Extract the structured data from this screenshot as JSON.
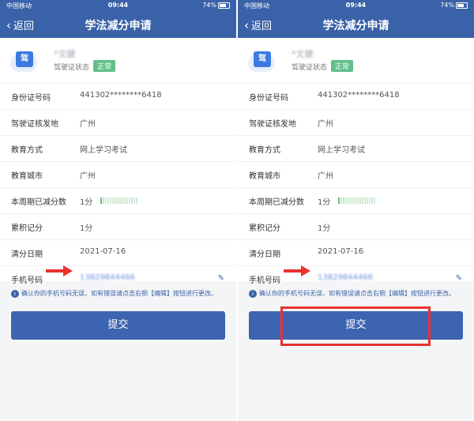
{
  "panels": [
    {
      "status": {
        "carrier": "中国移动",
        "time": "09:44",
        "battery": "74%"
      },
      "nav": {
        "back": "返回",
        "title": "学法减分申请"
      },
      "profile": {
        "name": "*文健",
        "license_label": "驾驶证状态",
        "license_status": "正常",
        "avatar_glyph": "驾"
      },
      "rows": [
        {
          "label": "身份证号码",
          "value": "441302********6418"
        },
        {
          "label": "驾驶证核发地",
          "value": "广州"
        },
        {
          "label": "教育方式",
          "value": "网上学习考试"
        },
        {
          "label": "教育城市",
          "value": "广州"
        },
        {
          "label": "本周期已减分数",
          "value": "1分",
          "progress_fraction": 0.08
        },
        {
          "label": "累积记分",
          "value": "1分"
        },
        {
          "label": "清分日期",
          "value": "2021-07-16"
        },
        {
          "label": "手机号码",
          "value": "13829844466",
          "edit_icon": "pencil-icon"
        }
      ],
      "notice": "确认你的手机号码无误，如有错误请点击右侧【编辑】按钮进行更改。",
      "submit_label": "提交",
      "annotation_color": "#e8332f"
    },
    {
      "status": {
        "carrier": "中国移动",
        "time": "09:44",
        "battery": "74%"
      },
      "nav": {
        "back": "返回",
        "title": "学法减分申请"
      },
      "profile": {
        "name": "*文健",
        "license_label": "驾驶证状态",
        "license_status": "正常",
        "avatar_glyph": "驾"
      },
      "rows": [
        {
          "label": "身份证号码",
          "value": "441302********6418"
        },
        {
          "label": "驾驶证核发地",
          "value": "广州"
        },
        {
          "label": "教育方式",
          "value": "网上学习考试"
        },
        {
          "label": "教育城市",
          "value": "广州"
        },
        {
          "label": "本周期已减分数",
          "value": "1分",
          "progress_fraction": 0.08
        },
        {
          "label": "累积记分",
          "value": "1分"
        },
        {
          "label": "清分日期",
          "value": "2021-07-16"
        },
        {
          "label": "手机号码",
          "value": "13829844466",
          "edit_icon": "pencil-icon"
        }
      ],
      "notice": "确认你的手机号码无误，如有错误请点击右侧【编辑】按钮进行更改。",
      "submit_label": "提交",
      "annotation_color": "#e8332f"
    }
  ],
  "colors": {
    "primary": "#3a62a8",
    "status_ok": "#5fc08a",
    "annotation": "#e8332f"
  }
}
